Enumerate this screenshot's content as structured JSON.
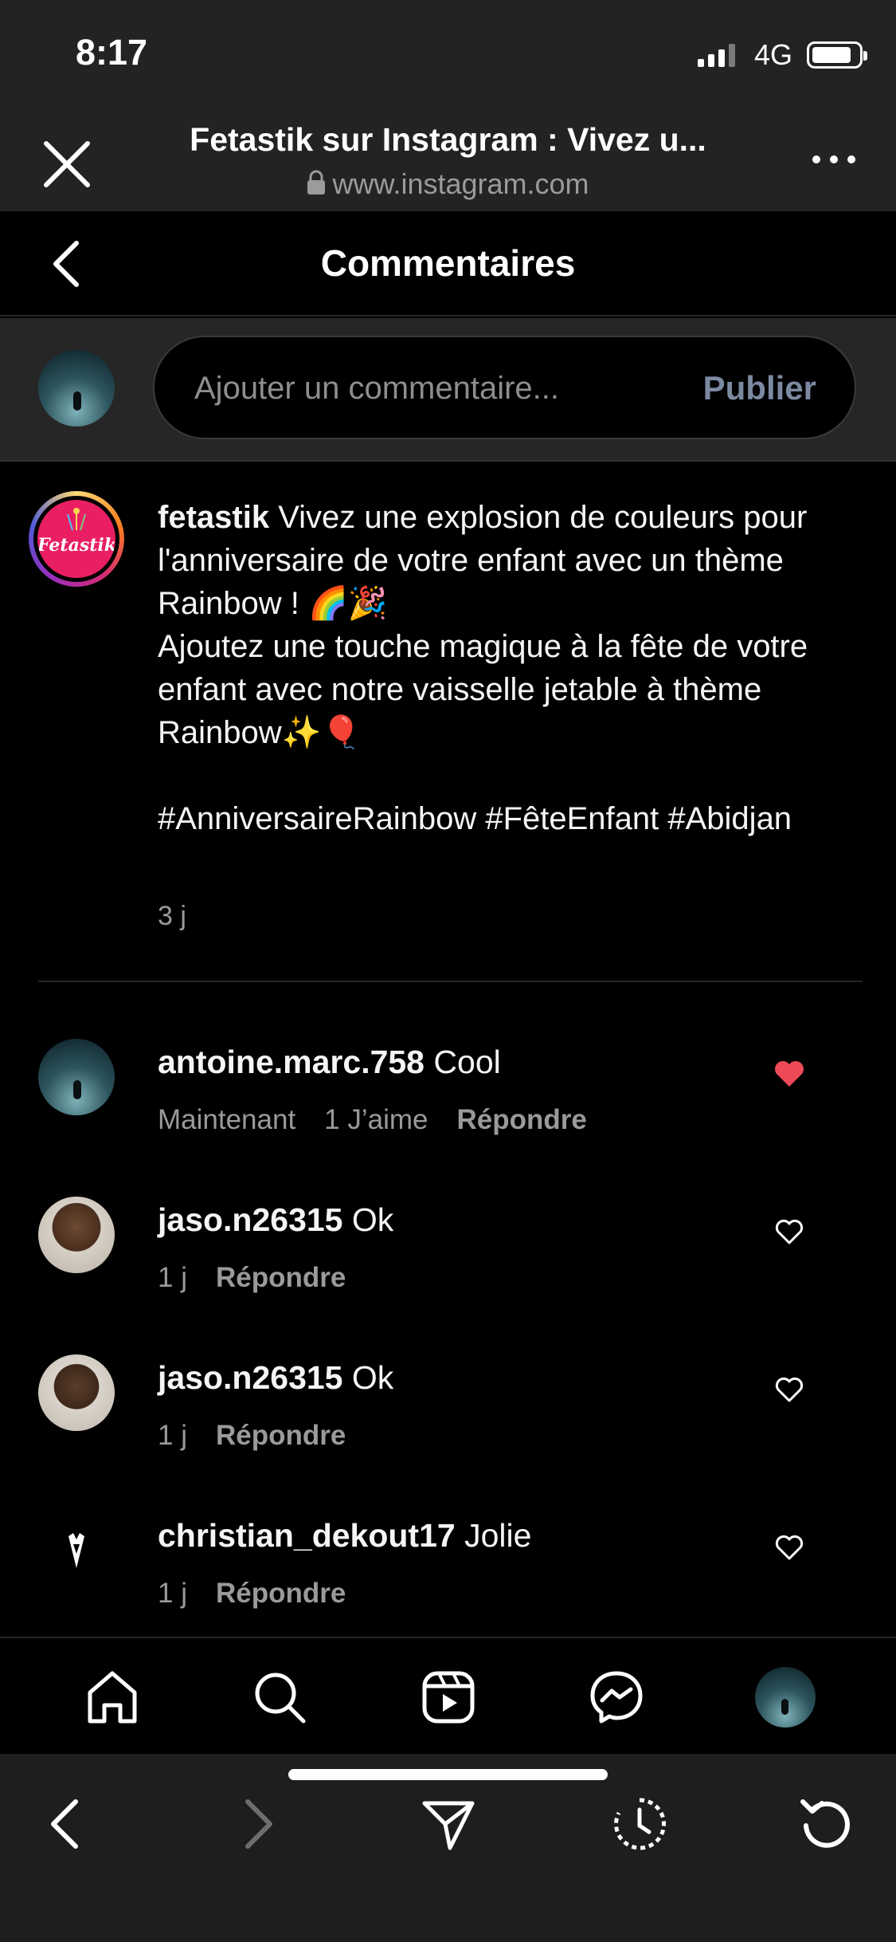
{
  "status_bar": {
    "time": "8:17",
    "network": "4G"
  },
  "browser": {
    "page_title": "Fetastik sur Instagram : Vivez u...",
    "url": "www.instagram.com"
  },
  "comments_header": {
    "title": "Commentaires"
  },
  "composer": {
    "placeholder": "Ajouter un commentaire...",
    "publish_label": "Publier"
  },
  "post": {
    "avatar_logo_text": "Fetastik",
    "username": "fetastik",
    "caption_line1": "Vivez une explosion de couleurs pour l'anniversaire de votre enfant avec un thème Rainbow ! 🌈🎉",
    "caption_line2": "Ajoutez une touche magique à la fête de votre enfant avec notre vaisselle jetable à thème Rainbow✨🎈",
    "hashtags": "#AnniversaireRainbow #FêteEnfant #Abidjan",
    "time": "3 j"
  },
  "comments": [
    {
      "username": "antoine.marc.758",
      "text": "Cool",
      "time": "Maintenant",
      "likes": "1 J’aime",
      "reply": "Répondre",
      "liked": true
    },
    {
      "username": "jaso.n26315",
      "text": "Ok",
      "time": "1 j",
      "reply": "Répondre",
      "liked": false
    },
    {
      "username": "jaso.n26315",
      "text": "Ok",
      "time": "1 j",
      "reply": "Répondre",
      "liked": false
    },
    {
      "username": "christian_dekout17",
      "text": "Jolie",
      "time": "1 j",
      "reply": "Répondre",
      "liked": false
    }
  ],
  "tabbar": {
    "icons": [
      "home-icon",
      "search-icon",
      "reels-icon",
      "messenger-icon",
      "profile-avatar"
    ]
  },
  "browser_toolbar": {
    "icons": [
      "back-icon",
      "forward-icon",
      "share-icon",
      "history-icon",
      "reload-icon"
    ]
  },
  "colors": {
    "background": "#000000",
    "bar": "#232323",
    "like_red": "#ed4956",
    "muted_text": "#9a9a9a",
    "publish_disabled": "#7b8aa1"
  }
}
